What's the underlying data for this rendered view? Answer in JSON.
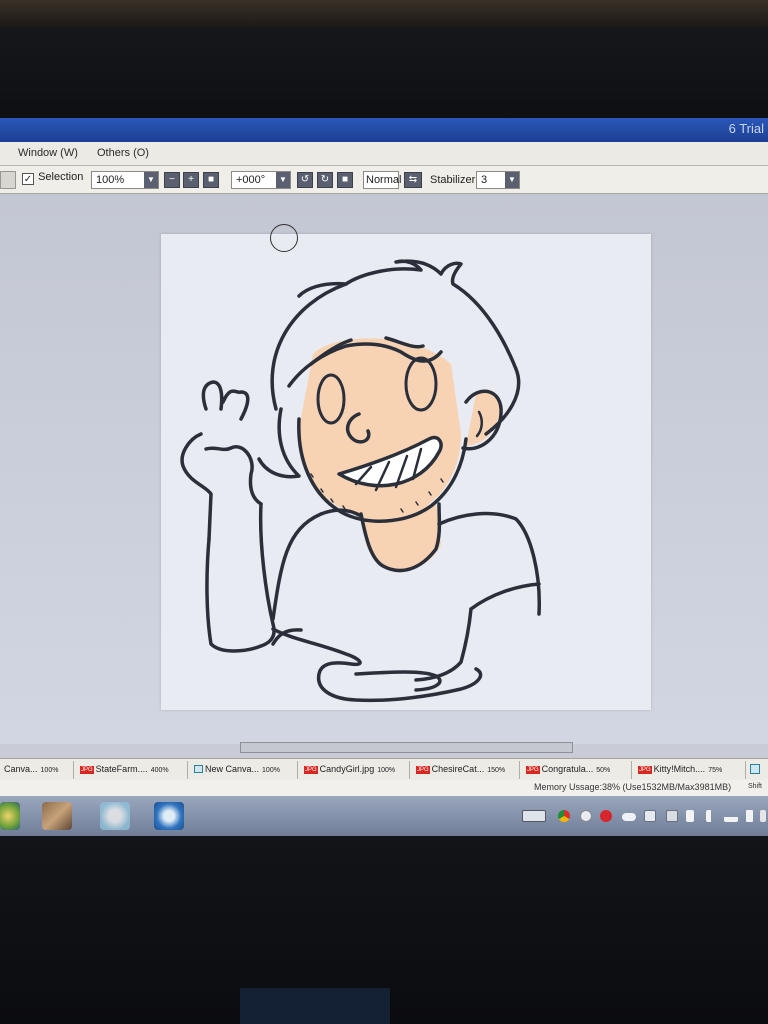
{
  "window": {
    "title_fragment": "6 Trial"
  },
  "menu": {
    "items": [
      "Window (W)",
      "Others (O)"
    ]
  },
  "toolbar": {
    "selection_label": "Selection",
    "selection_checked": true,
    "zoom_value": "100%",
    "rotation_value": "+000°",
    "blend_mode": "Normal",
    "stabilizer_label": "Stabilizer",
    "stabilizer_value": "3"
  },
  "tabs": [
    {
      "name": "Canva...",
      "zoom": "100%",
      "type": "canvas"
    },
    {
      "name": "StateFarm....",
      "zoom": "400%",
      "type": "jpg"
    },
    {
      "name": "New Canva...",
      "zoom": "100%",
      "type": "canvas"
    },
    {
      "name": "CandyGirl.jpg",
      "zoom": "100%",
      "type": "jpg"
    },
    {
      "name": "ChesireCat...",
      "zoom": "150%",
      "type": "jpg"
    },
    {
      "name": "Congratula...",
      "zoom": "50%",
      "type": "jpg"
    },
    {
      "name": "Kitty!Mitch....",
      "zoom": "75%",
      "type": "jpg"
    }
  ],
  "jpg_badge": "JPG",
  "status": {
    "memory": "Memory Ussage:38% (Use1532MB/Max3981MB)",
    "shift": "Shift"
  },
  "colors": {
    "skin": "#f7d3b3",
    "line": "#2b2f3a",
    "taskbar": "#7f8ca6",
    "titlebar": "#2a58b8"
  },
  "icons": {
    "checkbox": "check-icon",
    "dropdown": "chevron-down-icon",
    "zoom_out": "minus-icon",
    "zoom_in": "plus-icon",
    "rotate_left": "rotate-left-icon",
    "rotate_right": "rotate-right-icon",
    "swap": "swap-icon"
  }
}
